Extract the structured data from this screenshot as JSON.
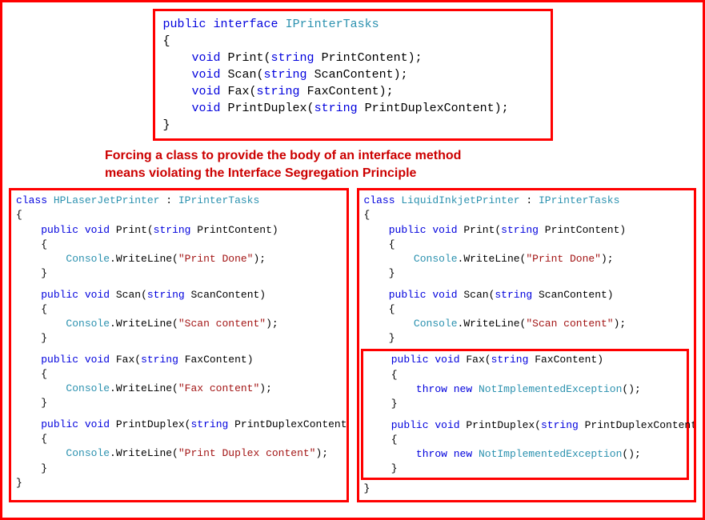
{
  "colors": {
    "accent": "#ff0000",
    "keyword": "#0000dd",
    "type": "#2b91af",
    "string": "#a31515"
  },
  "top_interface": {
    "line1_kw1": "public",
    "line1_kw2": "interface",
    "line1_name": "IPrinterTasks",
    "open": "{",
    "m1_kw": "void",
    "m1_name": " Print(",
    "m1_arg_kw": "string",
    "m1_arg_tail": " PrintContent);",
    "m2_kw": "void",
    "m2_name": " Scan(",
    "m2_arg_kw": "string",
    "m2_arg_tail": " ScanContent);",
    "m3_kw": "void",
    "m3_name": " Fax(",
    "m3_arg_kw": "string",
    "m3_arg_tail": " FaxContent);",
    "m4_kw": "void",
    "m4_name": " PrintDuplex(",
    "m4_arg_kw": "string",
    "m4_arg_tail": " PrintDuplexContent);",
    "close": "}"
  },
  "caption": {
    "line1": "Forcing a class to provide the body of an interface method",
    "line2": "means violating the Interface Segregation Principle"
  },
  "left": {
    "h_kw": "class",
    "h_name_head": " ",
    "h_name": "HPLaserJetPrinter",
    "h_tail1": " : ",
    "h_iface": "IPrinterTasks",
    "open": "{",
    "close": "}",
    "m1_sig_pre": "    ",
    "m1_kw1": "public",
    "m1_kw2": "void",
    "m1_sig_name": " Print(",
    "m1_arg_kw": "string",
    "m1_sig_tail": " PrintContent)",
    "m1_open": "    {",
    "m1_body_pre": "        ",
    "m1_body_type": "Console",
    "m1_body_mid": ".WriteLine(",
    "m1_body_str": "\"Print Done\"",
    "m1_body_tail": ");",
    "m1_close": "    }",
    "m2_sig_name": " Scan(",
    "m2_arg_kw": "string",
    "m2_sig_tail": " ScanContent)",
    "m2_body_str": "\"Scan content\"",
    "m3_sig_name": " Fax(",
    "m3_arg_kw": "string",
    "m3_sig_tail": " FaxContent)",
    "m3_body_str": "\"Fax content\"",
    "m4_sig_name": " PrintDuplex(",
    "m4_arg_kw": "string",
    "m4_sig_tail": " PrintDuplexContent)",
    "m4_body_str": "\"Print Duplex content\""
  },
  "right": {
    "h_kw": "class",
    "h_name": "LiquidInkjetPrinter",
    "h_tail1": " : ",
    "h_iface": "IPrinterTasks",
    "open": "{",
    "close": "}",
    "m1_sig_name": " Print(",
    "m1_arg_kw": "string",
    "m1_sig_tail": " PrintContent)",
    "m1_body_str": "\"Print Done\"",
    "m2_sig_name": " Scan(",
    "m2_arg_kw": "string",
    "m2_sig_tail": " ScanContent)",
    "m2_body_str": "\"Scan content\"",
    "m3_sig_name": " Fax(",
    "m3_arg_kw": "string",
    "m3_sig_tail": " FaxContent)",
    "m3_body_throw_kw1": "throw",
    "m3_body_throw_kw2": "new",
    "m3_body_throw_type": "NotImplementedException",
    "m3_body_throw_tail": "();",
    "m4_sig_name": " PrintDuplex(",
    "m4_arg_kw": "string",
    "m4_sig_tail": " PrintDuplexContent)"
  },
  "common": {
    "kw_public": "public",
    "kw_void": "void",
    "indent4": "    ",
    "indent8": "        ",
    "brace_open4": "    {",
    "brace_close4": "    }",
    "console": "Console",
    "writeline_open": ".WriteLine(",
    "tail_paren": ");"
  }
}
